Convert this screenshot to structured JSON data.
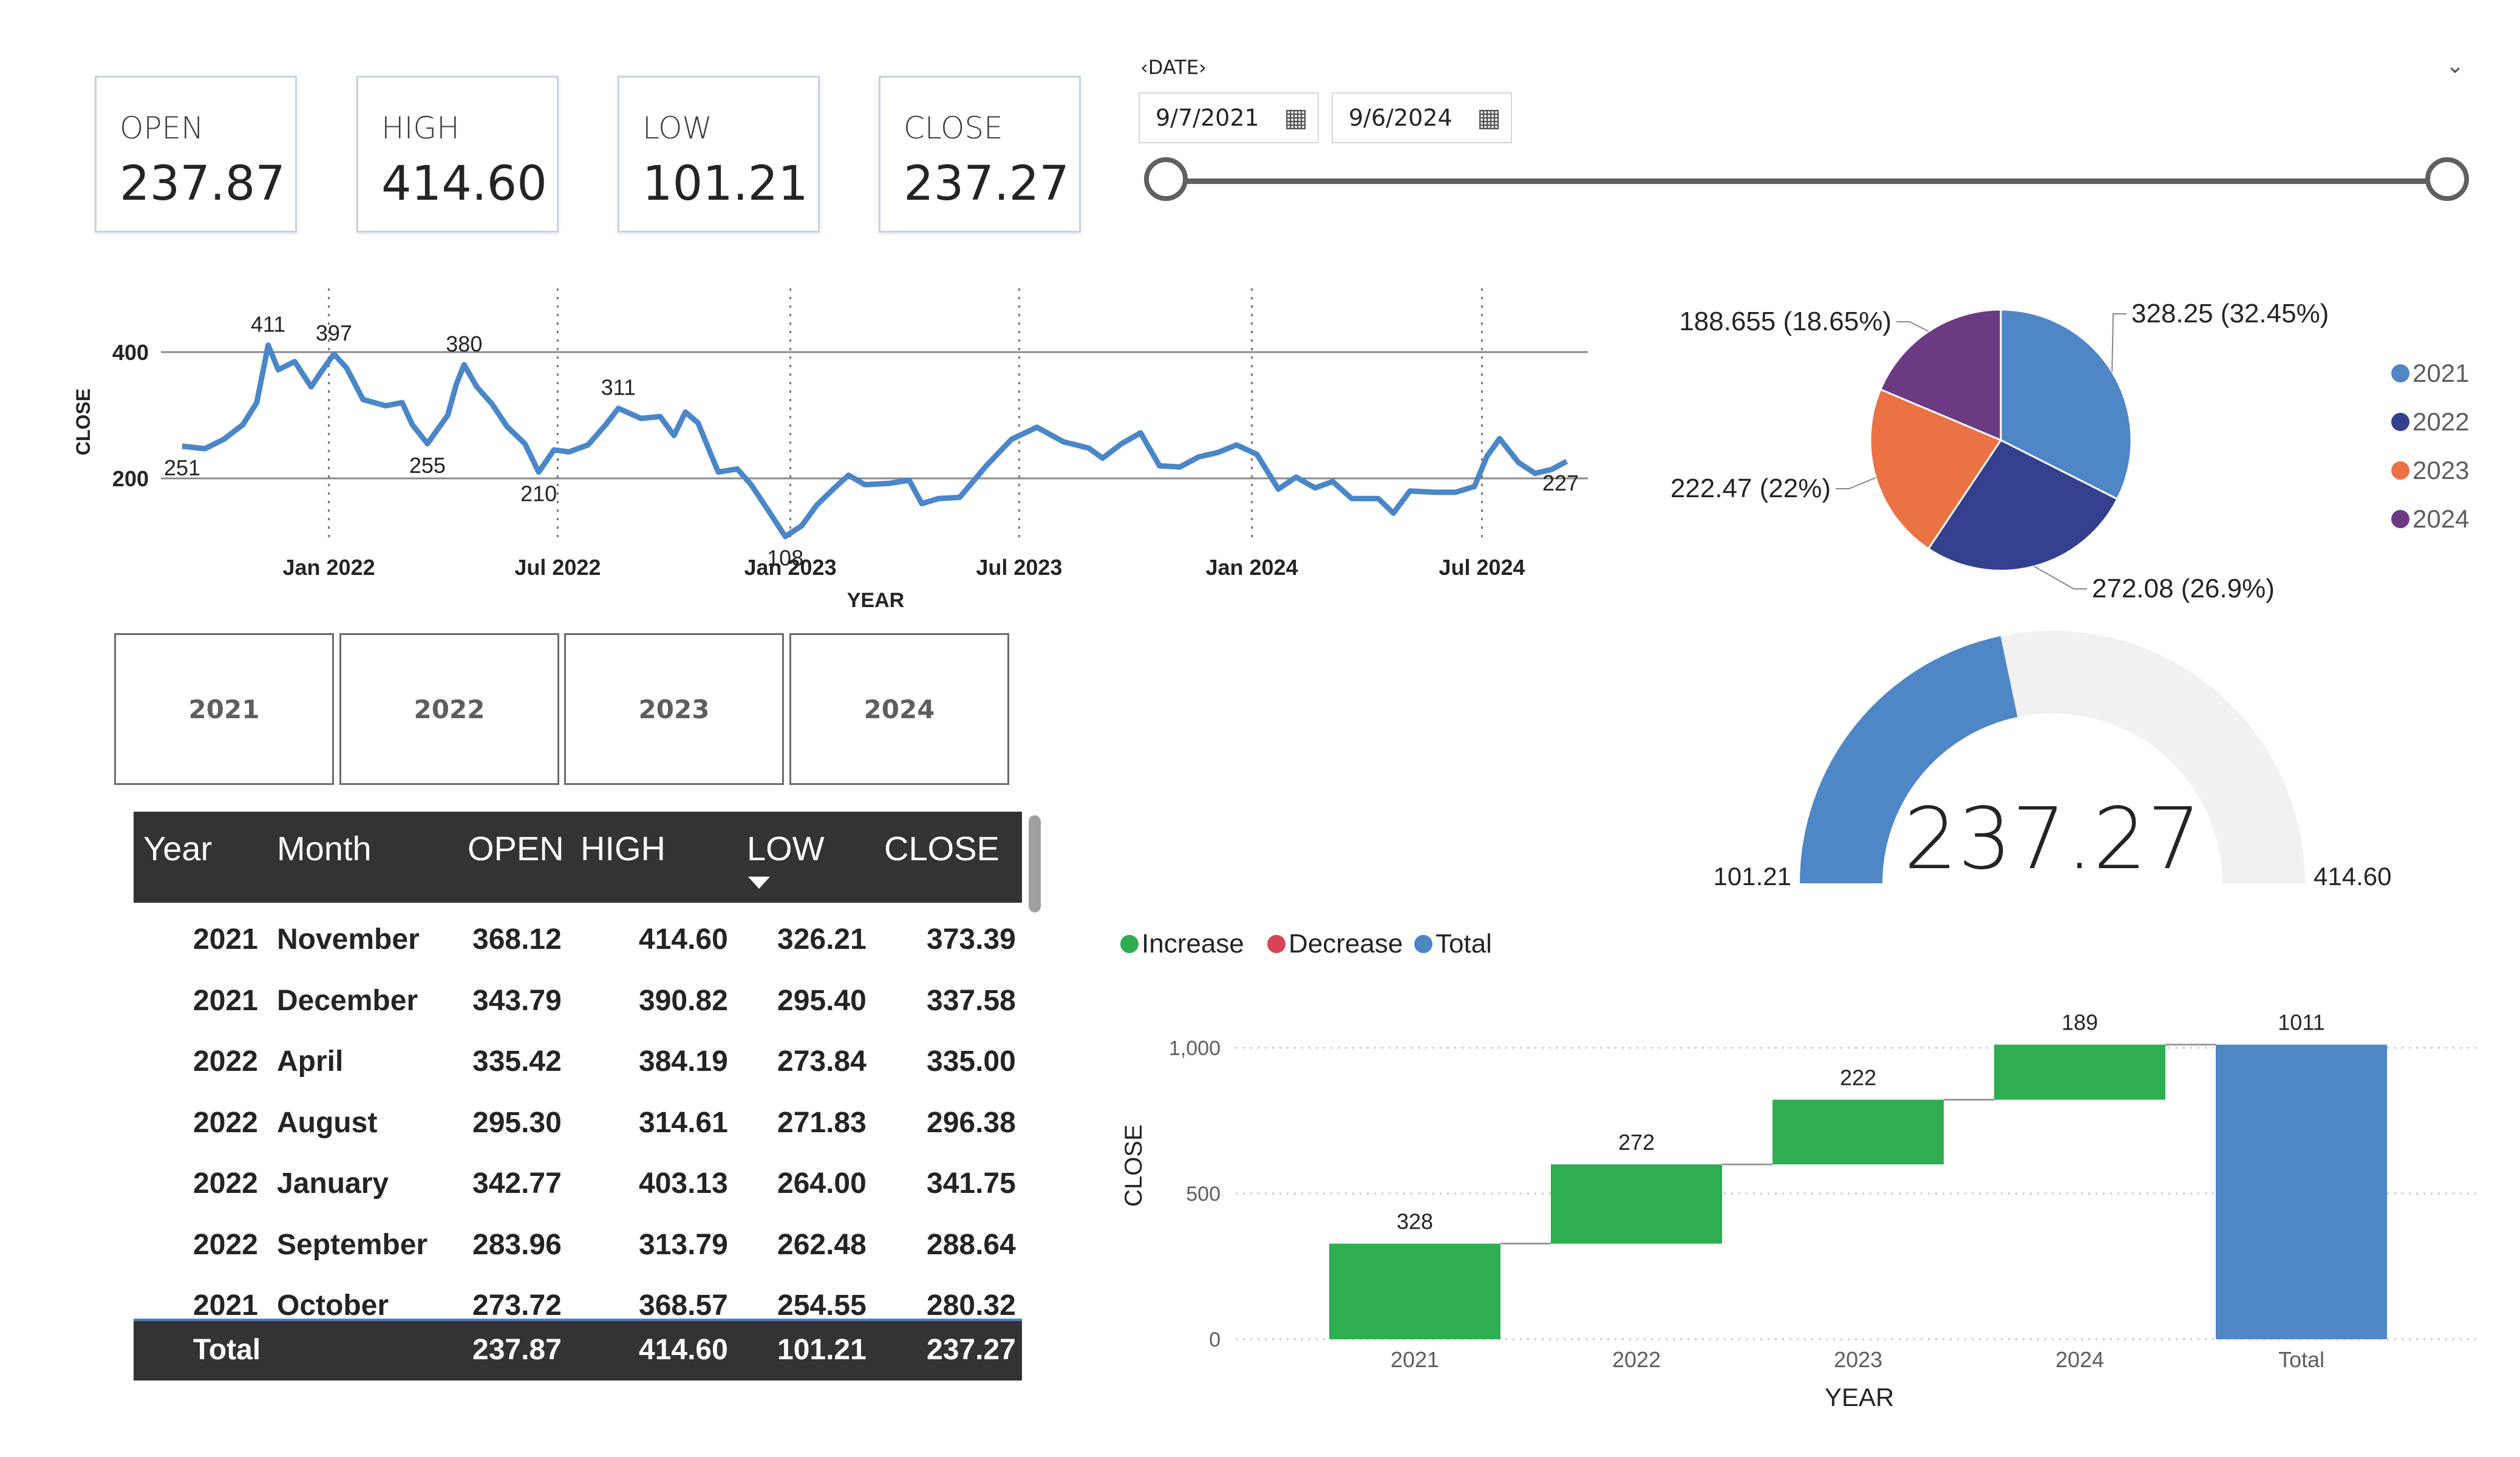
{
  "kpis": [
    {
      "label": "OPEN",
      "value": "237.87"
    },
    {
      "label": "HIGH",
      "value": "414.60"
    },
    {
      "label": "LOW",
      "value": "101.21"
    },
    {
      "label": "CLOSE",
      "value": "237.27"
    }
  ],
  "date_slicer": {
    "title": "DATE",
    "start": "9/7/2021",
    "end": "9/6/2024",
    "calendar_icon": "calendar-icon",
    "collapse_icon": "chevron-down-icon",
    "range": [
      0,
      1
    ]
  },
  "year_slicer": [
    "2021",
    "2022",
    "2023",
    "2024"
  ],
  "table": {
    "columns": [
      "Year",
      "Month",
      "OPEN",
      "HIGH",
      "LOW",
      "CLOSE"
    ],
    "sort_icon": "sort-descending-icon",
    "rows": [
      [
        "2021",
        "November",
        "368.12",
        "414.60",
        "326.21",
        "373.39"
      ],
      [
        "2021",
        "December",
        "343.79",
        "390.82",
        "295.40",
        "337.58"
      ],
      [
        "2022",
        "April",
        "335.42",
        "384.19",
        "273.84",
        "335.00"
      ],
      [
        "2022",
        "August",
        "295.30",
        "314.61",
        "271.83",
        "296.38"
      ],
      [
        "2022",
        "January",
        "342.77",
        "403.13",
        "264.00",
        "341.75"
      ],
      [
        "2022",
        "September",
        "283.96",
        "313.79",
        "262.48",
        "288.64"
      ],
      [
        "2021",
        "October",
        "273.72",
        "368.57",
        "254.55",
        "280.32"
      ]
    ],
    "total": [
      "Total",
      "237.87",
      "414.60",
      "101.21",
      "237.27"
    ]
  },
  "chart_data": [
    {
      "type": "line",
      "xlabel": "YEAR",
      "ylabel": "CLOSE",
      "x_ticks": [
        "Jan 2022",
        "Jul 2022",
        "Jan 2023",
        "Jul 2023",
        "Jan 2024",
        "Jul 2024"
      ],
      "y_ticks": [
        "200",
        "400"
      ],
      "ylim": [
        100,
        430
      ],
      "color": "#4a86c8",
      "points": [
        [
          "2021-09-07",
          251
        ],
        [
          "2021-09-25",
          247
        ],
        [
          "2021-10-10",
          262
        ],
        [
          "2021-10-25",
          285
        ],
        [
          "2021-11-05",
          320
        ],
        [
          "2021-11-14",
          411
        ],
        [
          "2021-11-22",
          372
        ],
        [
          "2021-12-05",
          385
        ],
        [
          "2021-12-18",
          345
        ],
        [
          "2021-12-25",
          366
        ],
        [
          "2022-01-05",
          397
        ],
        [
          "2022-01-15",
          375
        ],
        [
          "2022-01-28",
          325
        ],
        [
          "2022-02-15",
          315
        ],
        [
          "2022-02-28",
          320
        ],
        [
          "2022-03-08",
          285
        ],
        [
          "2022-03-20",
          255
        ],
        [
          "2022-04-05",
          300
        ],
        [
          "2022-04-12",
          350
        ],
        [
          "2022-04-18",
          380
        ],
        [
          "2022-04-28",
          345
        ],
        [
          "2022-05-10",
          318
        ],
        [
          "2022-05-22",
          282
        ],
        [
          "2022-06-05",
          255
        ],
        [
          "2022-06-16",
          210
        ],
        [
          "2022-06-28",
          245
        ],
        [
          "2022-07-10",
          242
        ],
        [
          "2022-07-25",
          253
        ],
        [
          "2022-08-08",
          285
        ],
        [
          "2022-08-18",
          311
        ],
        [
          "2022-09-05",
          295
        ],
        [
          "2022-09-20",
          298
        ],
        [
          "2022-10-01",
          268
        ],
        [
          "2022-10-10",
          305
        ],
        [
          "2022-10-20",
          288
        ],
        [
          "2022-11-05",
          210
        ],
        [
          "2022-11-20",
          215
        ],
        [
          "2022-12-01",
          190
        ],
        [
          "2022-12-15",
          148
        ],
        [
          "2022-12-28",
          108
        ],
        [
          "2023-01-10",
          125
        ],
        [
          "2023-01-22",
          158
        ],
        [
          "2023-02-05",
          185
        ],
        [
          "2023-02-16",
          205
        ],
        [
          "2023-03-01",
          190
        ],
        [
          "2023-03-20",
          192
        ],
        [
          "2023-04-05",
          197
        ],
        [
          "2023-04-15",
          160
        ],
        [
          "2023-04-28",
          168
        ],
        [
          "2023-05-15",
          170
        ],
        [
          "2023-06-05",
          220
        ],
        [
          "2023-06-25",
          262
        ],
        [
          "2023-07-15",
          281
        ],
        [
          "2023-08-05",
          258
        ],
        [
          "2023-08-25",
          248
        ],
        [
          "2023-09-05",
          232
        ],
        [
          "2023-09-20",
          255
        ],
        [
          "2023-10-05",
          272
        ],
        [
          "2023-10-20",
          220
        ],
        [
          "2023-11-05",
          218
        ],
        [
          "2023-11-20",
          234
        ],
        [
          "2023-12-05",
          241
        ],
        [
          "2023-12-20",
          253
        ],
        [
          "2024-01-05",
          238
        ],
        [
          "2024-01-22",
          183
        ],
        [
          "2024-02-05",
          202
        ],
        [
          "2024-02-20",
          185
        ],
        [
          "2024-03-05",
          195
        ],
        [
          "2024-03-20",
          168
        ],
        [
          "2024-04-10",
          168
        ],
        [
          "2024-04-22",
          145
        ],
        [
          "2024-05-05",
          180
        ],
        [
          "2024-05-25",
          178
        ],
        [
          "2024-06-10",
          178
        ],
        [
          "2024-06-25",
          187
        ],
        [
          "2024-07-05",
          235
        ],
        [
          "2024-07-15",
          263
        ],
        [
          "2024-07-30",
          225
        ],
        [
          "2024-08-12",
          208
        ],
        [
          "2024-08-25",
          214
        ],
        [
          "2024-09-06",
          227
        ]
      ],
      "annotations": [
        {
          "x": "2021-09-07",
          "y": 251,
          "text": "251"
        },
        {
          "x": "2021-11-14",
          "y": 411,
          "text": "411"
        },
        {
          "x": "2022-01-05",
          "y": 397,
          "text": "397"
        },
        {
          "x": "2022-03-20",
          "y": 255,
          "text": "255"
        },
        {
          "x": "2022-04-18",
          "y": 380,
          "text": "380"
        },
        {
          "x": "2022-06-16",
          "y": 210,
          "text": "210"
        },
        {
          "x": "2022-08-18",
          "y": 311,
          "text": "311"
        },
        {
          "x": "2022-12-28",
          "y": 108,
          "text": "108"
        },
        {
          "x": "2024-09-06",
          "y": 227,
          "text": "227"
        }
      ]
    },
    {
      "type": "pie",
      "categories": [
        "2021",
        "2022",
        "2023",
        "2024"
      ],
      "values": [
        328.25,
        272.08,
        222.47,
        188.655
      ],
      "labels": [
        "328.25 (32.45%)",
        "272.08 (26.9%)",
        "222.47 (22%)",
        "188.655 (18.65%)"
      ],
      "colors": [
        "#4f86c6",
        "#33408e",
        "#ea7244",
        "#6b3a82"
      ],
      "legend": "right"
    },
    {
      "type": "gauge",
      "min": 101.21,
      "max": 414.6,
      "value": 237.27,
      "min_label": "101.21",
      "max_label": "414.60",
      "value_label": "237.27",
      "colors": {
        "fill": "#4f86c6",
        "track": "#f1f1f1"
      }
    },
    {
      "type": "waterfall",
      "xlabel": "YEAR",
      "ylabel": "CLOSE",
      "categories": [
        "2021",
        "2022",
        "2023",
        "2024",
        "Total"
      ],
      "values": [
        328,
        272,
        222,
        189,
        1011
      ],
      "value_labels": [
        "328",
        "272",
        "222",
        "189",
        "1011"
      ],
      "y_ticks": [
        "0",
        "500",
        "1,000"
      ],
      "ylim": [
        0,
        1011
      ],
      "legend": [
        {
          "name": "Increase",
          "color": "#2ead51"
        },
        {
          "name": "Decrease",
          "color": "#d94454"
        },
        {
          "name": "Total",
          "color": "#4f86c6"
        }
      ]
    }
  ]
}
